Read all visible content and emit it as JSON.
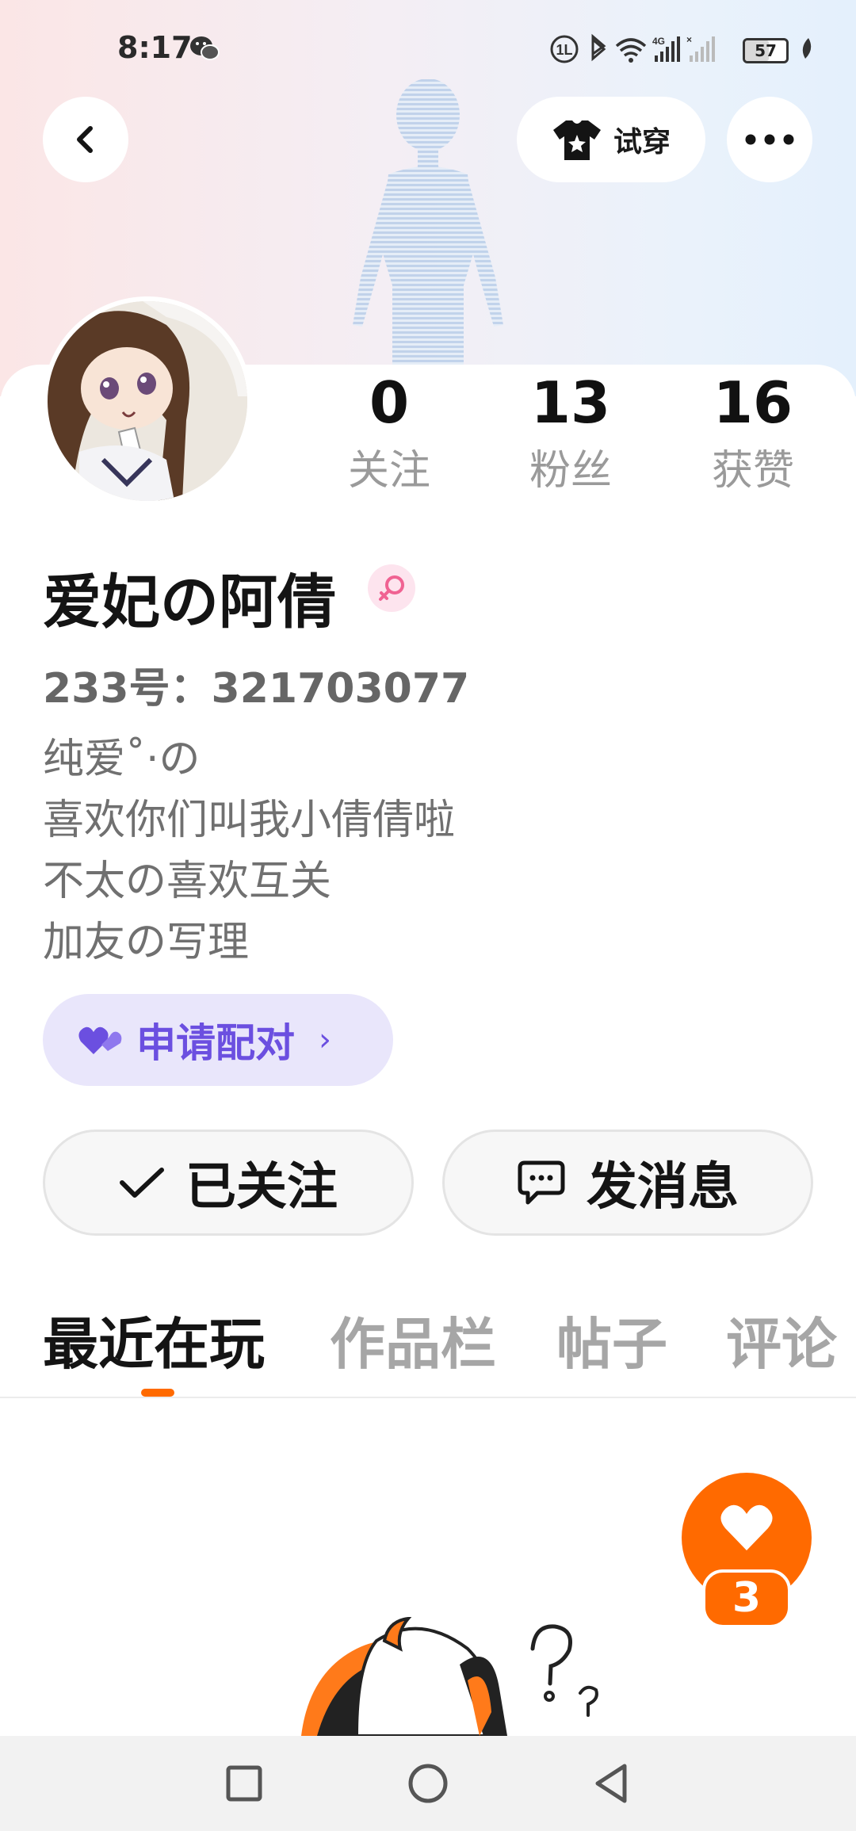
{
  "status_bar": {
    "time": "8:17",
    "battery": "57",
    "battery_level": 0.57,
    "icons": [
      "wechat-icon",
      "hd-icon",
      "bluetooth-icon",
      "wifi-icon",
      "signal-4g-icon",
      "signal-no-sim-icon",
      "battery-icon",
      "leaf-icon"
    ]
  },
  "header": {
    "tryon_label": "试穿"
  },
  "profile": {
    "username": "爱妃の阿倩",
    "gender": "female",
    "uid": "233号：321703077",
    "bio": [
      "纯爱˚·の",
      "喜欢你们叫我小倩倩啦",
      "不太の喜欢互关",
      "加友の写理"
    ]
  },
  "stats": [
    {
      "value": "0",
      "label": "关注"
    },
    {
      "value": "13",
      "label": "粉丝"
    },
    {
      "value": "16",
      "label": "获赞"
    }
  ],
  "actions": {
    "match_label": "申请配对",
    "follow_label": "已关注",
    "message_label": "发消息"
  },
  "tabs": [
    {
      "label": "最近在玩",
      "active": true
    },
    {
      "label": "作品栏",
      "active": false
    },
    {
      "label": "帖子",
      "active": false
    },
    {
      "label": "评论",
      "active": false
    }
  ],
  "fab": {
    "badge": "3"
  },
  "colors": {
    "accent": "#ff6a00",
    "match_purple": "#6b4fe0",
    "match_bg": "#e9e6fb",
    "gender_pink": "#f06292"
  }
}
